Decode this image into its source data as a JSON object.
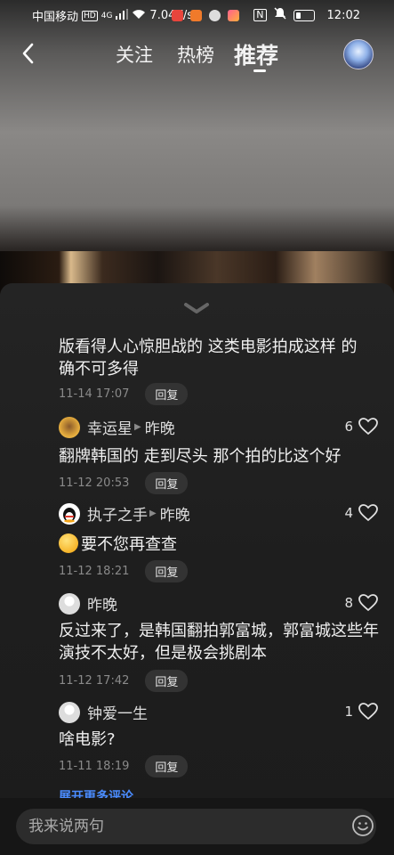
{
  "status_bar": {
    "carrier": "中国移动",
    "hd_badge": "HD",
    "network": "4G",
    "speed": "7.04K/s",
    "nfc": "N",
    "time": "12:02"
  },
  "nav": {
    "tabs": [
      {
        "label": "关注"
      },
      {
        "label": "热榜"
      },
      {
        "label": "推荐"
      }
    ],
    "back_icon": "chevron-left-icon",
    "profile_icon": "avatar"
  },
  "comments": [
    {
      "text": "版看得人心惊胆战的 这类电影拍成这样 的确不可多得",
      "time": "11-14 17:07",
      "reply_label": "回复"
    },
    {
      "user": "幸运星",
      "reply_to": "昨晚",
      "text": "翻牌韩国的 走到尽头 那个拍的比这个好",
      "time": "11-12 20:53",
      "reply_label": "回复",
      "likes": "6",
      "avatar_color": "#e2a93c"
    },
    {
      "user": "执子之手",
      "reply_to": "昨晚",
      "text": "要不您再查查",
      "time": "11-12 18:21",
      "reply_label": "回复",
      "likes": "4",
      "avatar_color": "#ffffff"
    },
    {
      "user": "昨晚",
      "text": "反过来了，是韩国翻拍郭富城，郭富城这些年演技不太好，但是极会挑剧本",
      "time": "11-12 17:42",
      "reply_label": "回复",
      "likes": "8",
      "avatar_color": "#dddddd"
    },
    {
      "user": "钟爱一生",
      "text": "啥电影?",
      "time": "11-11 18:19",
      "reply_label": "回复",
      "likes": "1",
      "avatar_color": "#dddddd"
    }
  ],
  "expand_more_label": "展开更多评论",
  "input": {
    "placeholder": "我来说两句",
    "emoji_icon": "smiley-icon"
  },
  "colors": {
    "accent_link": "#4a8cff",
    "sheet_bg": "#1f1f1f",
    "meta_text": "#8a8a8a"
  }
}
